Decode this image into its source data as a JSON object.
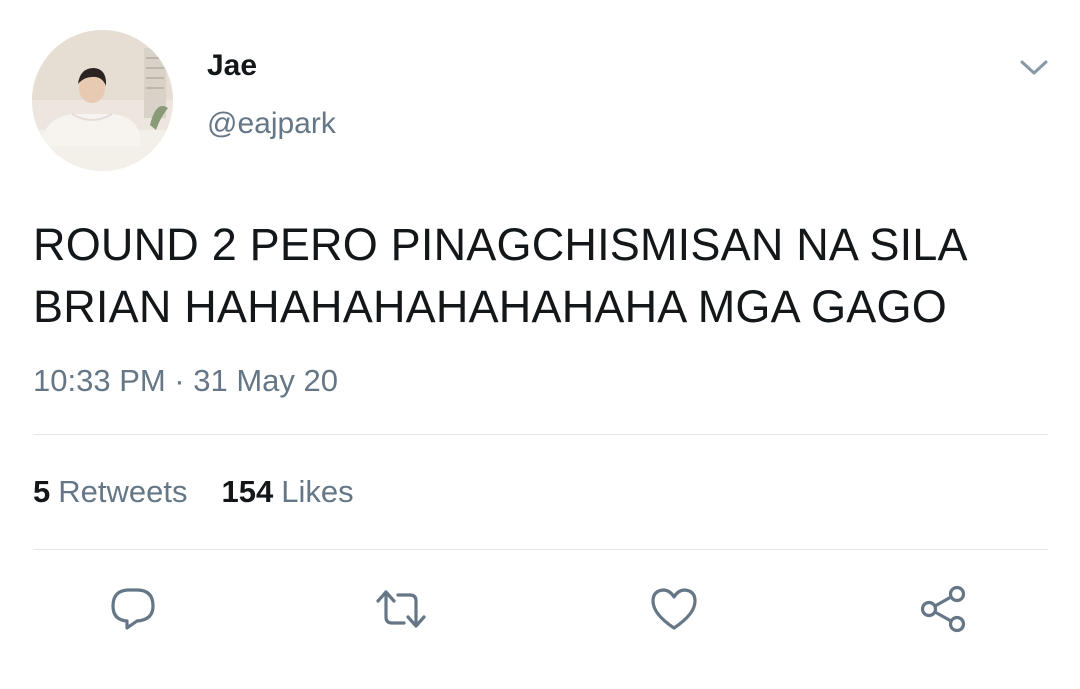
{
  "tweet": {
    "display_name": "Jae",
    "handle": "@eajpark",
    "text_line1": "ROUND 2 PERO PINAGCHISMISAN NA SILA",
    "text_line2": "BRIAN HAHAHAHAHAHAHAHA MGA GAGO",
    "timestamp": "10:33 PM · 31 May 20"
  },
  "stats": {
    "retweets_count": "5",
    "retweets_label": "Retweets",
    "likes_count": "154",
    "likes_label": "Likes"
  },
  "icons": {
    "menu": "chevron-down-icon",
    "reply": "reply-icon",
    "retweet": "retweet-icon",
    "like": "heart-icon",
    "share": "share-icon"
  },
  "colors": {
    "text_primary": "#14171a",
    "text_secondary": "#657786",
    "icon": "#657786",
    "divider": "#e1e8ed"
  }
}
